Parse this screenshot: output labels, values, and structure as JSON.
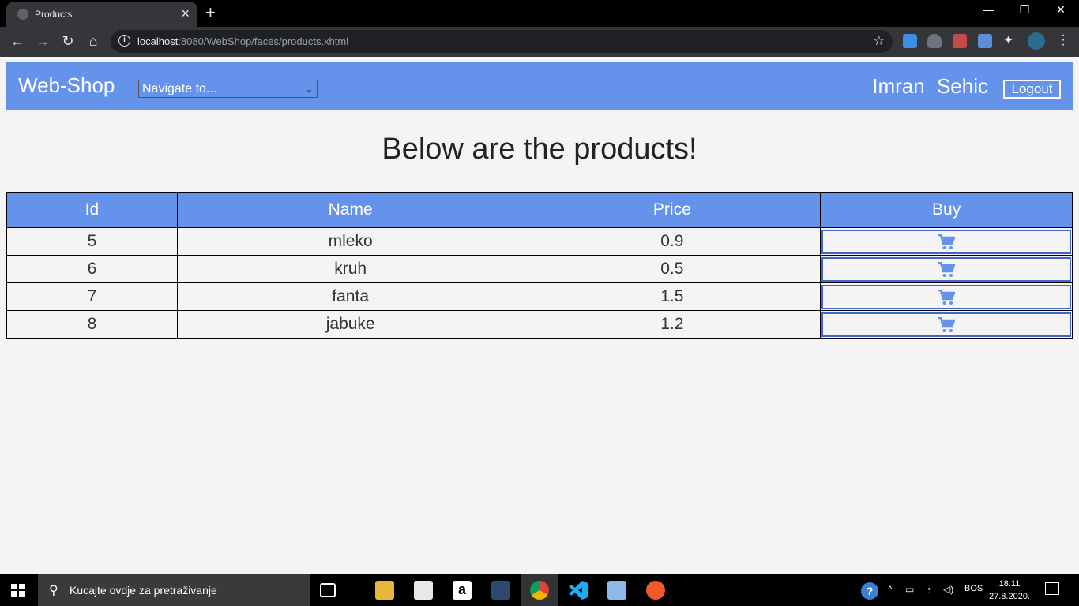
{
  "browser": {
    "tab_title": "Products",
    "url_host": "localhost",
    "url_rest": ":8080/WebShop/faces/products.xhtml",
    "window_controls": {
      "minimize": "—",
      "restore": "❐",
      "close": "✕"
    }
  },
  "navbar": {
    "brand": "Web-Shop",
    "navigate_select": "Navigate to...",
    "username": "Imran Sehic",
    "logout_label": "Logout"
  },
  "main": {
    "heading": "Below are the products!"
  },
  "table": {
    "headers": {
      "id": "Id",
      "name": "Name",
      "price": "Price",
      "buy": "Buy"
    },
    "rows": [
      {
        "id": "5",
        "name": "mleko",
        "price": "0.9"
      },
      {
        "id": "6",
        "name": "kruh",
        "price": "0.5"
      },
      {
        "id": "7",
        "name": "fanta",
        "price": "1.5"
      },
      {
        "id": "8",
        "name": "jabuke",
        "price": "1.2"
      }
    ]
  },
  "taskbar": {
    "search_placeholder": "Kucajte ovdje za pretraživanje",
    "language": "BOS",
    "time": "18:11",
    "date": "27.8.2020."
  },
  "colors": {
    "navbar": "#6593ec",
    "accent_border": "#3f66c8",
    "cart_icon": "#6593ec"
  }
}
